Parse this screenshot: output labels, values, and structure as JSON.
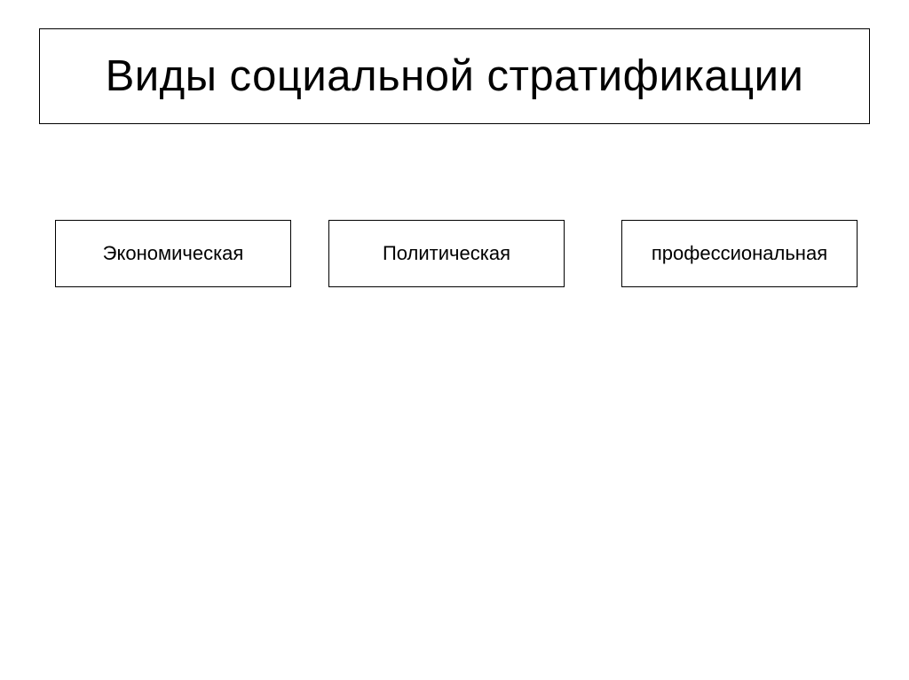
{
  "title": "Виды социальной стратификации",
  "items": [
    "Экономическая",
    "Политическая",
    "профессиональная"
  ]
}
